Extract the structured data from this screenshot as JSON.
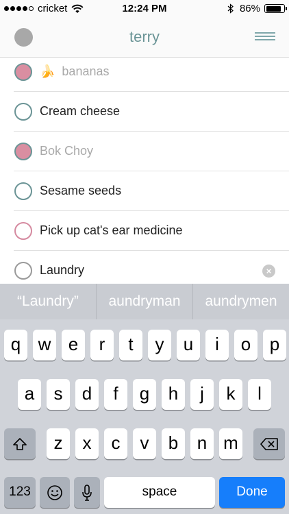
{
  "status_bar": {
    "carrier": "cricket",
    "time": "12:24 PM",
    "battery_percent": "86%",
    "battery_level": 0.86,
    "signal_bars_filled": 4,
    "signal_bars_total": 5
  },
  "header": {
    "title": "terry",
    "avatar_color": "#a8a8a8",
    "title_color": "#6a9496"
  },
  "list": {
    "items": [
      {
        "emoji": "🍌",
        "label": "bananas",
        "completed": true
      },
      {
        "label": "Cream cheese",
        "completed": false
      },
      {
        "label": "Bok Choy",
        "completed": true
      },
      {
        "label": "Sesame seeds",
        "completed": false
      },
      {
        "label": "Pick up cat's ear medicine",
        "completed": false
      },
      {
        "label": "Laundry",
        "completed": false,
        "editing": true
      }
    ],
    "completed_fill_color": "#d98ea1",
    "ring_color": "#6b9496"
  },
  "keyboard": {
    "suggestions": [
      "“Laundry”",
      "aundryman",
      "aundrymen"
    ],
    "row1": [
      "q",
      "w",
      "e",
      "r",
      "t",
      "y",
      "u",
      "i",
      "o",
      "p"
    ],
    "row2": [
      "a",
      "s",
      "d",
      "f",
      "g",
      "h",
      "j",
      "k",
      "l"
    ],
    "row3": [
      "z",
      "x",
      "c",
      "v",
      "b",
      "n",
      "m"
    ],
    "numbers_label": "123",
    "space_label": "space",
    "done_label": "Done",
    "done_color": "#167efb",
    "icons": {
      "shift": "shift-icon",
      "backspace": "backspace-icon",
      "emoji": "emoji-icon",
      "mic": "microphone-icon"
    }
  }
}
